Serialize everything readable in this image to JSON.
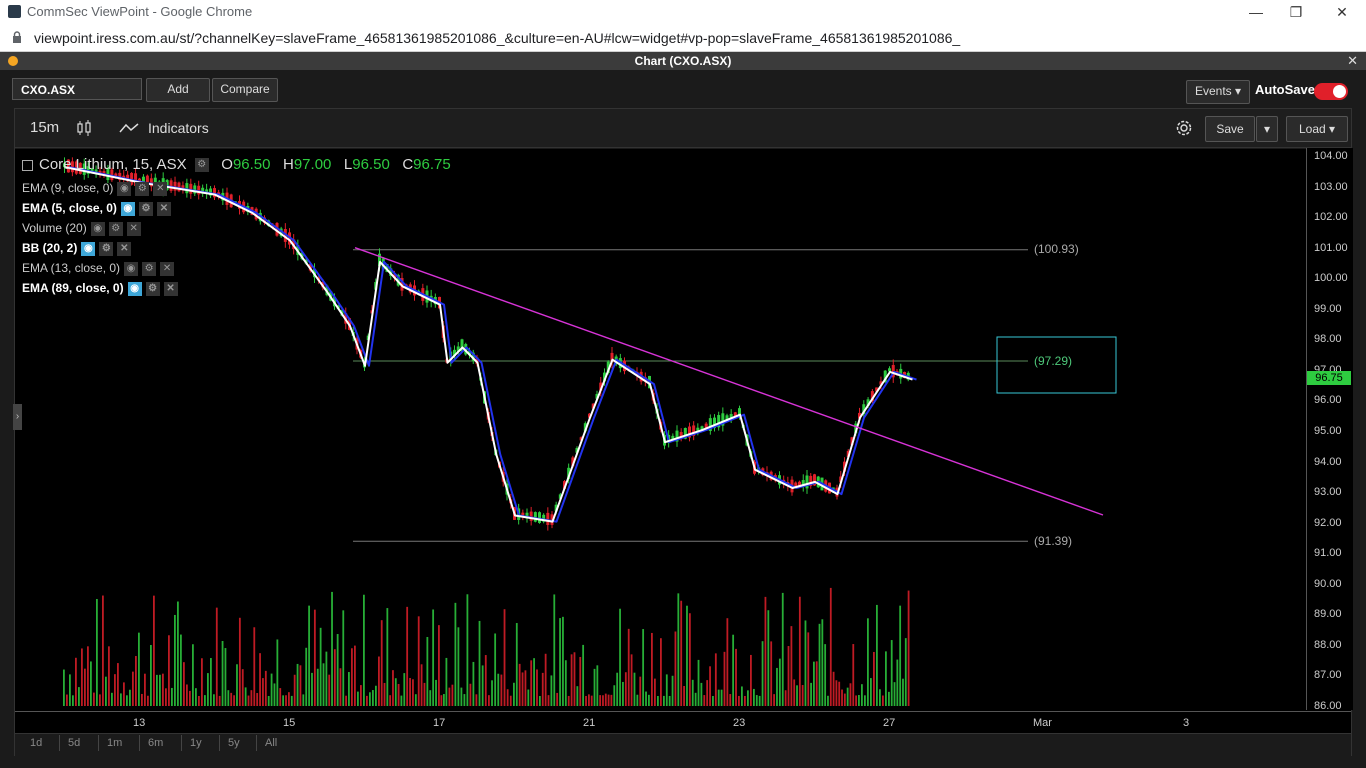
{
  "browser": {
    "window_title": "CommSec ViewPoint - Google Chrome",
    "url": "viewpoint.iress.com.au/st/?channelKey=slaveFrame_46581361985201086_&culture=en-AU#lcw=widget#vp-pop=slaveFrame_46581361985201086_",
    "minimize": "—",
    "restore": "❐",
    "close": "✕"
  },
  "app": {
    "title": "Chart (CXO.ASX)",
    "close": "✕"
  },
  "header": {
    "symbol": "CXO.ASX",
    "add_label": "Add",
    "compare_label": "Compare",
    "events_label": "Events ▾",
    "autosave_label": "AutoSave",
    "autosave_on": true
  },
  "toolbar": {
    "timeframe": "15m",
    "indicators_label": "Indicators",
    "save_label": "Save",
    "save_caret": "▾",
    "load_label": "Load ▾"
  },
  "legend": {
    "instrument": "Core Lithium, 15, ASX",
    "o_label": "O",
    "o": "96.50",
    "h_label": "H",
    "h": "97.00",
    "l_label": "L",
    "l": "96.50",
    "c_label": "C",
    "c": "96.75",
    "indicators": [
      {
        "label": "EMA (9, close, 0)",
        "visible": false
      },
      {
        "label": "EMA (5, close, 0)",
        "visible": true
      },
      {
        "label": "Volume (20)",
        "visible": false
      },
      {
        "label": "BB (20, 2)",
        "visible": true
      },
      {
        "label": "EMA (13, close, 0)",
        "visible": false
      },
      {
        "label": "EMA (89, close, 0)",
        "visible": true
      }
    ]
  },
  "annotations": {
    "resistance_label": "(100.93)",
    "mid_label": "(97.29)",
    "support_label": "(91.39)",
    "last_price": "96.75"
  },
  "range_buttons": [
    "1d",
    "5d",
    "1m",
    "6m",
    "1y",
    "5y",
    "All"
  ],
  "colors": {
    "up": "#2ecc40",
    "down": "#e0202a",
    "trendline": "#d633d6",
    "ema_fast": "#ffffff",
    "ema_slow": "#2233ee",
    "box": "#38c7d6",
    "mid_line": "#5a8a5a"
  },
  "chart_data": {
    "type": "line",
    "title": "Core Lithium, 15, ASX",
    "y_ticks": [
      "104.00",
      "103.00",
      "102.00",
      "101.00",
      "100.00",
      "99.00",
      "98.00",
      "97.00",
      "96.00",
      "95.00",
      "94.00",
      "93.00",
      "92.00",
      "91.00",
      "90.00",
      "89.00",
      "88.00",
      "87.00",
      "86.00"
    ],
    "x_ticks": [
      "13",
      "15",
      "17",
      "21",
      "23",
      "27",
      "Mar",
      "3"
    ],
    "ylim": [
      86,
      104
    ],
    "price_path": [
      {
        "x": "12",
        "y": 103.7
      },
      {
        "x": "13",
        "y": 103.2
      },
      {
        "x": "14",
        "y": 102.8
      },
      {
        "x": "14.5",
        "y": 102.2
      },
      {
        "x": "15",
        "y": 101.3
      },
      {
        "x": "15.5",
        "y": 99.6
      },
      {
        "x": "15.8",
        "y": 98.5
      },
      {
        "x": "16",
        "y": 97.2
      },
      {
        "x": "16.2",
        "y": 100.6
      },
      {
        "x": "16.5",
        "y": 99.8
      },
      {
        "x": "17",
        "y": 99.2
      },
      {
        "x": "17.2",
        "y": 97.3
      },
      {
        "x": "17.6",
        "y": 97.8
      },
      {
        "x": "18",
        "y": 97.3
      },
      {
        "x": "18.5",
        "y": 94.3
      },
      {
        "x": "19",
        "y": 92.3
      },
      {
        "x": "20",
        "y": 92.1
      },
      {
        "x": "21",
        "y": 95.5
      },
      {
        "x": "21.3",
        "y": 97.4
      },
      {
        "x": "21.8",
        "y": 96.6
      },
      {
        "x": "22",
        "y": 94.7
      },
      {
        "x": "22.5",
        "y": 95.1
      },
      {
        "x": "23",
        "y": 95.6
      },
      {
        "x": "23.2",
        "y": 93.8
      },
      {
        "x": "23.7",
        "y": 93.2
      },
      {
        "x": "24",
        "y": 93.4
      },
      {
        "x": "24.3",
        "y": 93.0
      },
      {
        "x": "24.6",
        "y": 95.5
      },
      {
        "x": "25",
        "y": 97.0
      },
      {
        "x": "25.3",
        "y": 96.75
      }
    ],
    "levels": [
      {
        "label": "(100.93)",
        "y": 100.93
      },
      {
        "label": "(97.29)",
        "y": 97.29
      },
      {
        "label": "(91.39)",
        "y": 91.39
      }
    ],
    "trendline": {
      "from": {
        "x": "16",
        "y": 101.0
      },
      "to": {
        "x": "Mar",
        "y": 92.2
      }
    },
    "last_price": 96.75
  }
}
